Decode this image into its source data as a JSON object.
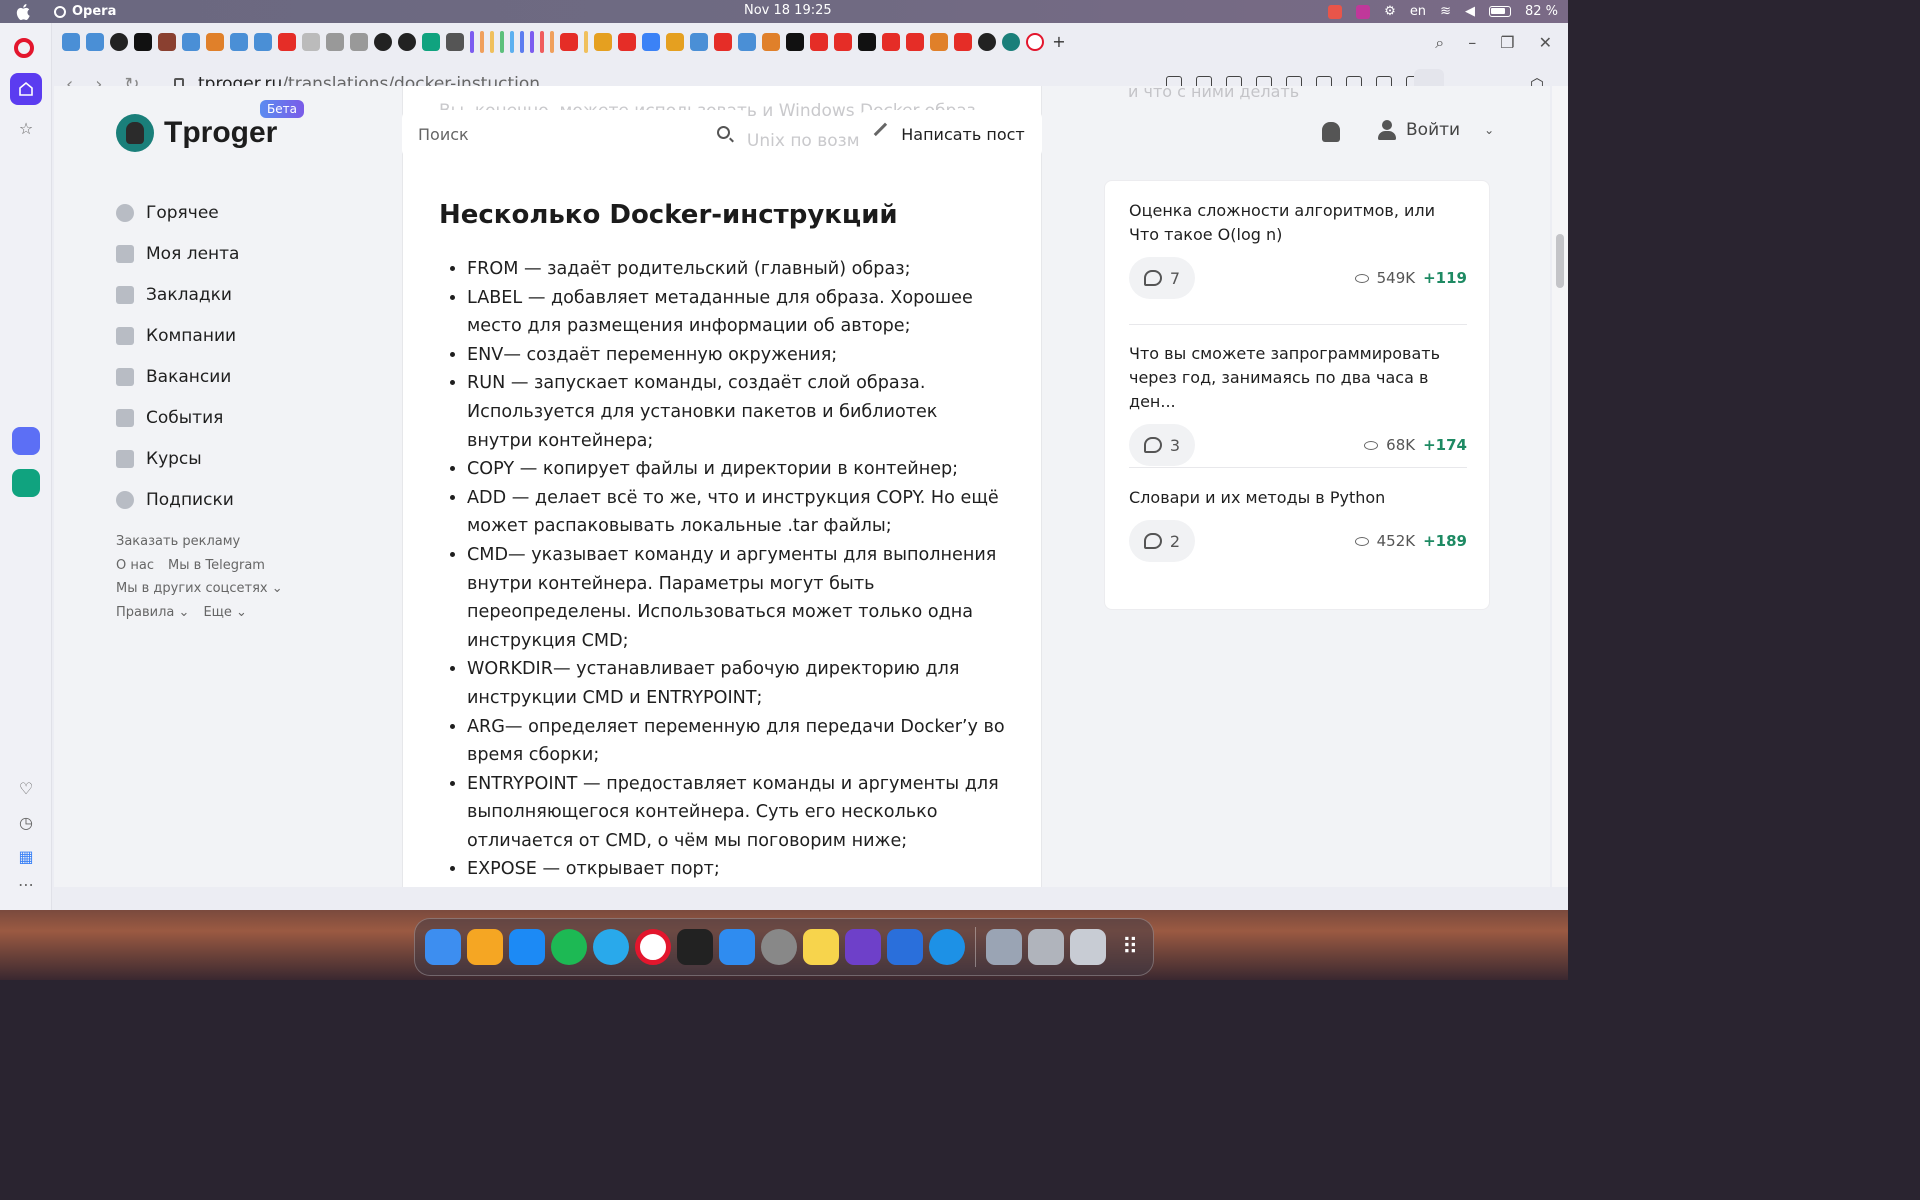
{
  "menubar": {
    "app_name": "Opera",
    "datetime": "Nov 18  19:25",
    "language": "en",
    "battery": "82 %"
  },
  "browser": {
    "url_domain": "tproger.ru",
    "url_path": "/translations/docker-instuction"
  },
  "site": {
    "logo_text": "Tproger",
    "beta_label": "Бета",
    "search_placeholder": "Поиск",
    "write_post_label": "Написать пост",
    "login_label": "Войти"
  },
  "nav": {
    "items": [
      {
        "label": "Горячее",
        "icon": "fire-icon"
      },
      {
        "label": "Моя лента",
        "icon": "feed-icon"
      },
      {
        "label": "Закладки",
        "icon": "bookmark-icon"
      },
      {
        "label": "Компании",
        "icon": "buildings-icon"
      },
      {
        "label": "Вакансии",
        "icon": "briefcase-icon"
      },
      {
        "label": "События",
        "icon": "calendar-icon"
      },
      {
        "label": "Курсы",
        "icon": "graduation-cap-icon"
      },
      {
        "label": "Подписки",
        "icon": "subscriptions-icon"
      }
    ],
    "footer": {
      "ads": "Заказать рекламу",
      "about": "О нас",
      "telegram": "Мы в Telegram",
      "social": "Мы в других соцсетях",
      "rules": "Правила",
      "more": "Еще"
    }
  },
  "article": {
    "faded_text": "Вы, конечно, можете использовать и Windows Docker-образ применяют. Так что, пользуйтесь Unix по возможности.",
    "heading": "Несколько Docker-инструкций",
    "items": [
      "FROM — задаёт родительский (главный) образ;",
      "LABEL — добавляет метаданные для образа. Хорошее место для размещения информации об авторе;",
      "ENV— создаёт переменную окружения;",
      "RUN — запускает команды, создаёт слой образа. Используется для установки пакетов и библиотек внутри контейнера;",
      "COPY — копирует файлы и директории в контейнер;",
      "ADD — делает всё то же, что и инструкция COPY. Но ещё может распаковывать локальные .tar файлы;",
      "CMD— указывает команду и аргументы для выполнения внутри контейнера. Параметры могут быть переопределены. Использоваться может только одна инструкция CMD;",
      "WORKDIR— устанавливает рабочую директорию для инструкции CMD и ENTRYPOINT;",
      "ARG— определяет переменную для передачи Docker’у во время сборки;",
      "ENTRYPOINT — предоставляет команды и аргументы для выполняющегося контейнера. Суть его несколько отличается от CMD, о чём мы поговорим ниже;",
      "EXPOSE — открывает порт;"
    ]
  },
  "sidebar_right": {
    "faded_text": "и что с ними делать",
    "posts": [
      {
        "title": "Оценка сложности алгоритмов, или Что такое O(log n)",
        "comments": "7",
        "views": "549K",
        "rating": "+119"
      },
      {
        "title": "Что вы сможете запрограммировать через год, занимаясь по два часа в ден...",
        "comments": "3",
        "views": "68K",
        "rating": "+174"
      },
      {
        "title": "Словари и их методы в Python",
        "comments": "2",
        "views": "452K",
        "rating": "+189"
      }
    ]
  },
  "colors": {
    "accent": "#5b3cf0",
    "rating_green": "#1e8a63",
    "opera_red": "#e3162d"
  }
}
